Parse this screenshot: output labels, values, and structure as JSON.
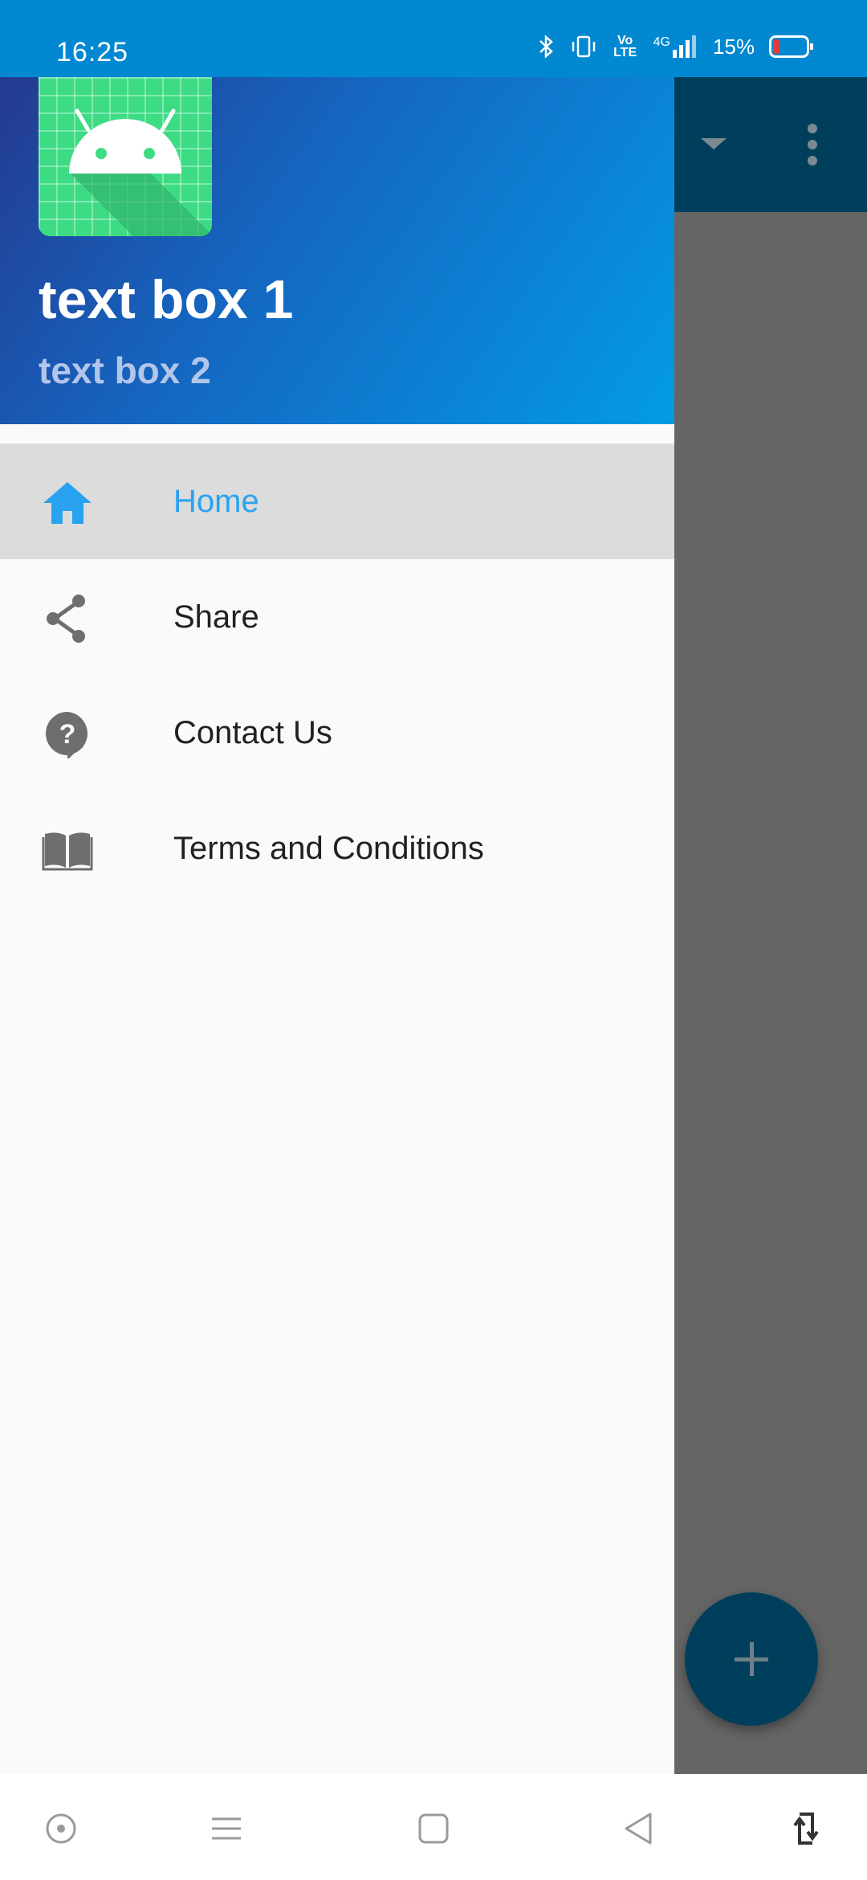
{
  "status_bar": {
    "time": "16:25",
    "network": "4G",
    "volte": "Vo LTE",
    "battery_text": "15%",
    "icons": [
      "bluetooth-icon",
      "vibrate-icon",
      "volte-icon",
      "signal-icon",
      "battery-icon"
    ]
  },
  "drawer": {
    "header": {
      "title": "text box 1",
      "subtitle": "text box 2",
      "logo": "android-logo"
    },
    "items": [
      {
        "label": "Home",
        "icon": "home-icon",
        "active": true
      },
      {
        "label": "Share",
        "icon": "share-icon",
        "active": false
      },
      {
        "label": "Contact Us",
        "icon": "help-icon",
        "active": false
      },
      {
        "label": "Terms and Conditions",
        "icon": "book-icon",
        "active": false
      }
    ]
  },
  "app": {
    "toolbar_icons": [
      "dropdown-arrow-icon",
      "overflow-menu-icon"
    ],
    "fab_icon": "add-icon"
  },
  "nav_bar": {
    "icons": [
      "assistant-icon",
      "menu-icon",
      "home-square-icon",
      "back-icon",
      "rotate-icon"
    ]
  },
  "colors": {
    "status_bar": "#0288d1",
    "accent": "#29a3f0",
    "toolbar": "#003f5c",
    "android_green": "#3ddc84",
    "scrim": "#656565"
  }
}
